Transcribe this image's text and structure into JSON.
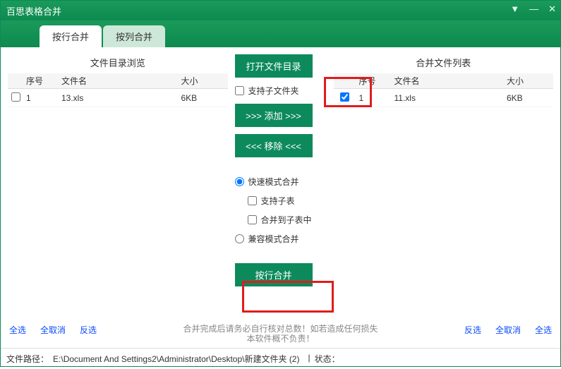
{
  "title": "百思表格合并",
  "tabs": {
    "active": "按行合并",
    "inactive": "按列合并"
  },
  "leftPanel": {
    "title": "文件目录浏览",
    "headers": {
      "seq": "序号",
      "name": "文件名",
      "size": "大小"
    },
    "rows": [
      {
        "seq": "1",
        "name": "13.xls",
        "size": "6KB"
      }
    ]
  },
  "rightPanel": {
    "title": "合并文件列表",
    "headers": {
      "seq": "序号",
      "name": "文件名",
      "size": "大小"
    },
    "rows": [
      {
        "seq": "1",
        "name": "11.xls",
        "size": "6KB"
      }
    ]
  },
  "controls": {
    "openDir": "打开文件目录",
    "supportSub": "支持子文件夹",
    "add": ">>>  添加  >>>",
    "remove": "<<<  移除  <<<",
    "fastMerge": "快速模式合并",
    "supportSubTable": "支持子表",
    "mergeToSub": "合并到子表中",
    "compatMerge": "兼容模式合并",
    "mergeBtn": "按行合并"
  },
  "footer": {
    "selectAll": "全选",
    "deselectAll": "全取消",
    "invert": "反选",
    "note": "合并完成后请务必自行核对总数！如若造成任何损失本软件概不负责！"
  },
  "status": {
    "pathLabel": "文件路径：",
    "path": "E:\\Document And Settings2\\Administrator\\Desktop\\新建文件夹 (2)",
    "stateLabel": "状态："
  }
}
